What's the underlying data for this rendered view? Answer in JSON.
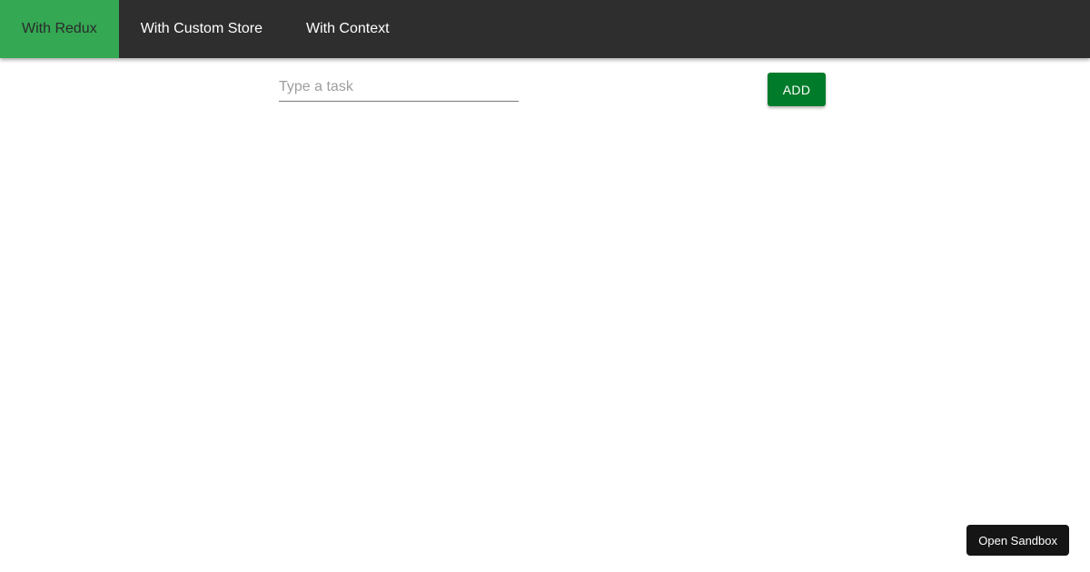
{
  "nav": {
    "tabs": [
      {
        "label": "With Redux",
        "active": true
      },
      {
        "label": "With Custom Store",
        "active": false
      },
      {
        "label": "With Context",
        "active": false
      }
    ]
  },
  "task_form": {
    "input_value": "",
    "input_placeholder": "Type a task",
    "add_label": "ADD"
  },
  "sandbox": {
    "label": "Open Sandbox"
  },
  "colors": {
    "topbar": "#2e2e2e",
    "active_tab": "#34a853",
    "add_button": "#007b2a",
    "sandbox_button": "#151515"
  }
}
